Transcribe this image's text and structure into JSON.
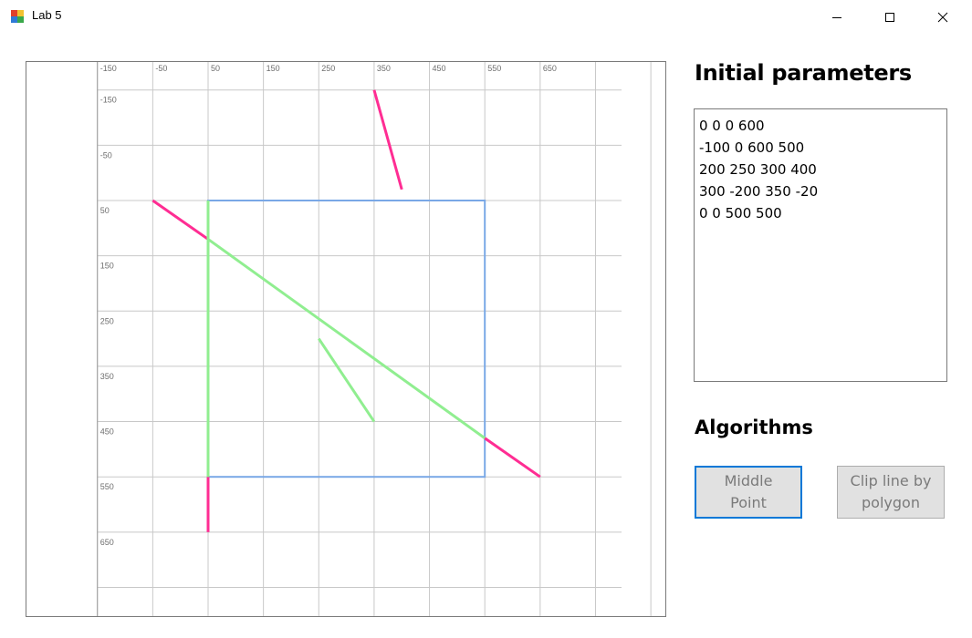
{
  "window": {
    "title": "Lab 5"
  },
  "panel": {
    "params_title": "Initial parameters",
    "params_text": "0 0 0 600\n-100 0 600 500\n200 250 300 400\n300 -200 350 -20\n0 0 500 500",
    "algorithms_title": "Algorithms",
    "buttons": {
      "middle_point": "Middle\nPoint",
      "clip_polygon": "Clip line by\npolygon"
    }
  },
  "canvas": {
    "x_ticks": [
      "-150",
      "-50",
      "50",
      "150",
      "250",
      "350",
      "450",
      "550",
      "650"
    ],
    "y_ticks": [
      "-150",
      "-50",
      "50",
      "150",
      "250",
      "350",
      "450",
      "550",
      "650"
    ]
  },
  "scene": {
    "clip_window": {
      "x1": 0,
      "y1": 0,
      "x2": 500,
      "y2": 500,
      "color": "#7aa8e6"
    },
    "segments_outside": [
      {
        "x1": 0,
        "y1": 500,
        "x2": 0,
        "y2": 600
      },
      {
        "x1": -100,
        "y1": 0,
        "x2": 0,
        "y2": 70
      },
      {
        "x1": 500,
        "y1": 430,
        "x2": 600,
        "y2": 500
      },
      {
        "x1": 300,
        "y1": -200,
        "x2": 350,
        "y2": -20
      }
    ],
    "segments_inside": [
      {
        "x1": 0,
        "y1": 0,
        "x2": 0,
        "y2": 500
      },
      {
        "x1": 0,
        "y1": 70,
        "x2": 500,
        "y2": 430
      },
      {
        "x1": 200,
        "y1": 250,
        "x2": 300,
        "y2": 400
      }
    ],
    "colors": {
      "outside": "#ff2d93",
      "inside": "#90ee90",
      "grid": "#c8c8c8"
    }
  }
}
